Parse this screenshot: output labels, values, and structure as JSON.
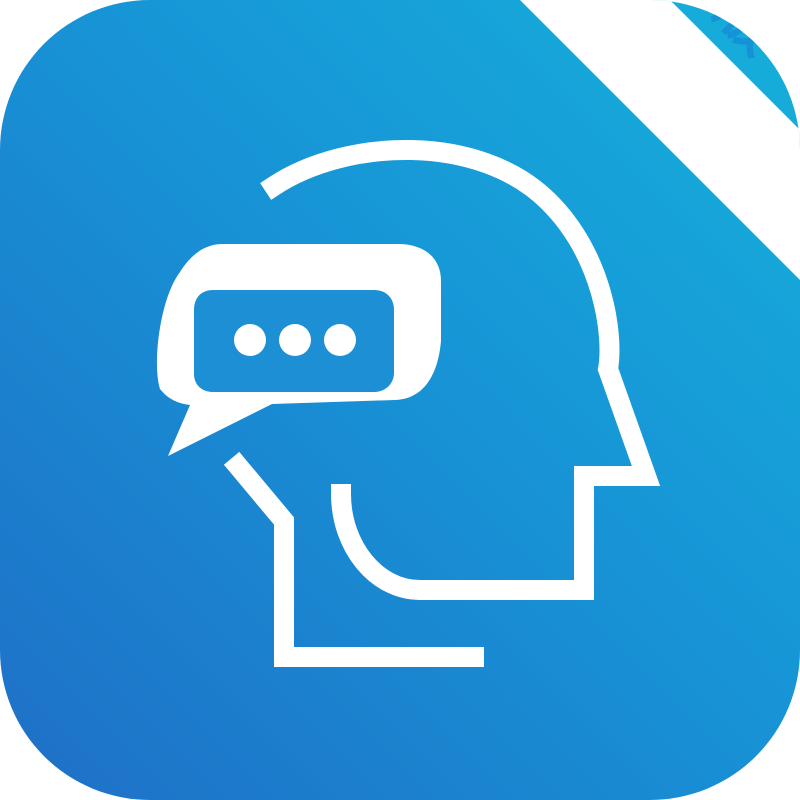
{
  "app_icon": {
    "badge_text": "专家版",
    "colors": {
      "background_light": "#16b0db",
      "background_mid": "#1794d6",
      "background_dark": "#1f6fc7",
      "foreground": "#ffffff",
      "badge_text": "#1693d7"
    },
    "icons": {
      "main_glyph": "head-with-chat-bubble-icon",
      "dots": "ellipsis-icon"
    }
  }
}
